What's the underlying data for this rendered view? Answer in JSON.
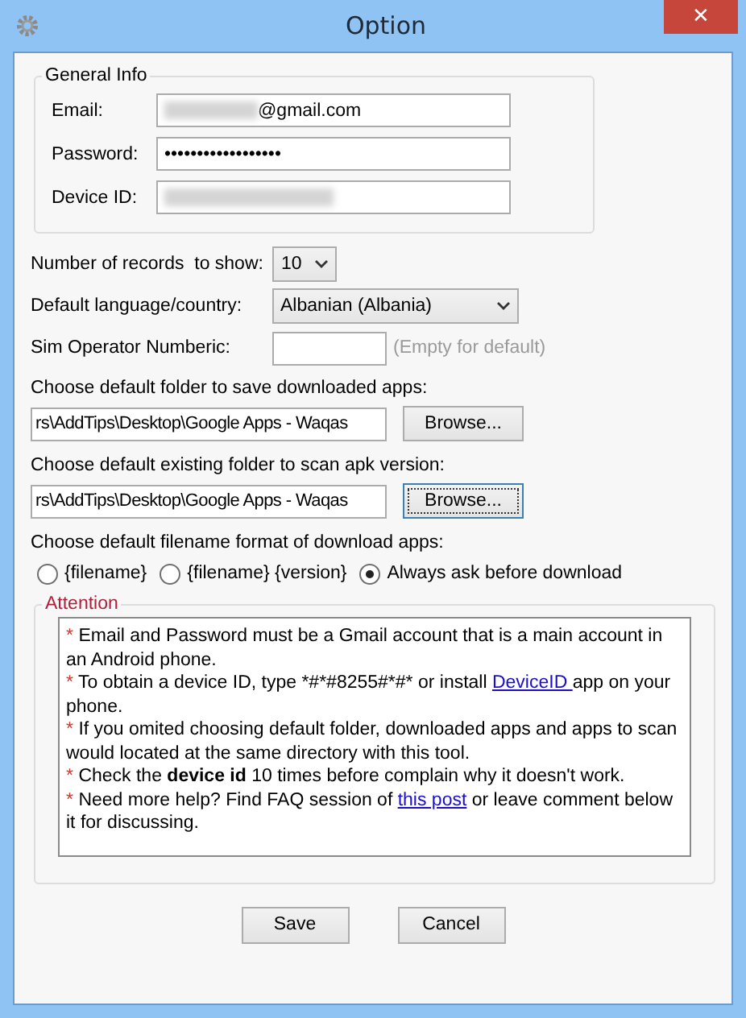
{
  "window": {
    "title": "Option",
    "close": "✕"
  },
  "general_info": {
    "legend": "General Info",
    "fields": [
      {
        "label": "Email:",
        "value": "@gmail.com",
        "redacted": true,
        "kind": "text"
      },
      {
        "label": "Password:",
        "value": "••••••••••••••••••",
        "redacted": false,
        "kind": "text"
      },
      {
        "label": "Device ID:",
        "redacted": true,
        "kind": "text"
      }
    ]
  },
  "records": {
    "label": "Number of records  to show:",
    "value": "10"
  },
  "language": {
    "label": "Default language/country:",
    "value": "Albanian (Albania)"
  },
  "sim": {
    "label": "Sim Operator Numberic:",
    "hint": "(Empty for default)"
  },
  "folders": [
    {
      "label": "Choose default folder to save downloaded apps:",
      "value": "rs\\AddTips\\Desktop\\Google Apps - Waqas",
      "button": "Browse...",
      "focused": false
    },
    {
      "label": "Choose default existing folder to scan apk version:",
      "value": "rs\\AddTips\\Desktop\\Google Apps - Waqas",
      "button": "Browse...",
      "focused": true
    }
  ],
  "filename_format": {
    "label": "Choose default filename format of download apps:",
    "options": [
      {
        "label": "{filename}",
        "selected": false
      },
      {
        "label": "{filename} {version}",
        "selected": false
      },
      {
        "label": "Always ask before download",
        "selected": true
      }
    ]
  },
  "attention": {
    "legend": "Attention",
    "notes": [
      {
        "bullet": "*",
        "parts": [
          {
            "kind": "text",
            "text": "Email and Password must be a Gmail account that is a main account in an Android phone."
          }
        ]
      },
      {
        "bullet": "*",
        "parts": [
          {
            "kind": "text",
            "text": "To obtain a device ID, type *#*#8255#*#* or install "
          },
          {
            "kind": "link",
            "text": "DeviceID "
          },
          {
            "kind": "text",
            "text": "app on your phone."
          }
        ]
      },
      {
        "bullet": "*",
        "parts": [
          {
            "kind": "text",
            "text": "If you omited choosing default folder, downloaded apps and apps to scan would located at the same directory with this tool."
          }
        ]
      },
      {
        "bullet": "*",
        "parts": [
          {
            "kind": "rich",
            "text": "Check the **device id** 10 times before complain why it doesn't work."
          }
        ]
      },
      {
        "bullet": "*",
        "parts": [
          {
            "kind": "text",
            "text": "Need more help? Find FAQ session of "
          },
          {
            "kind": "link",
            "text": "this post"
          },
          {
            "kind": "text",
            "text": " or leave comment below it for discussing."
          }
        ]
      }
    ]
  },
  "buttons": [
    "Save",
    "Cancel"
  ]
}
